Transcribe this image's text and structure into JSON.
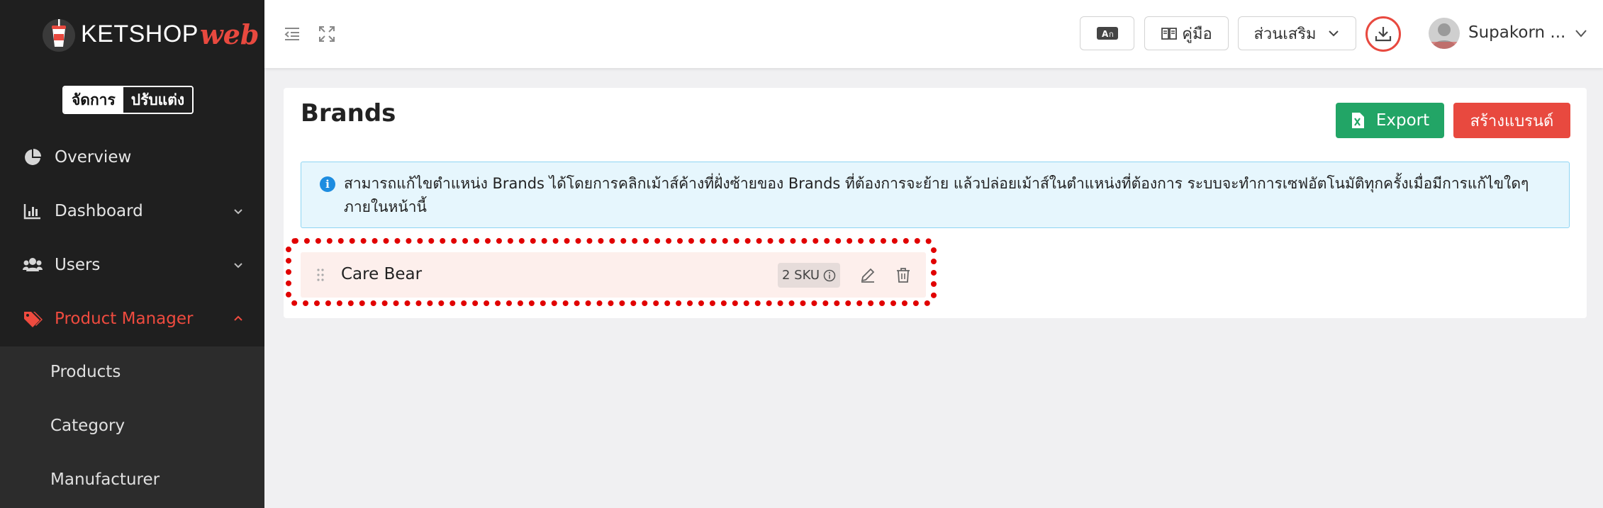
{
  "sidebar": {
    "logo": {
      "text": "KETSHOP",
      "accent": "web"
    },
    "mode_toggle": {
      "active": "จัดการ",
      "inactive": "ปรับแต่ง"
    },
    "items": [
      {
        "label": "Overview",
        "icon": "pie-chart-icon"
      },
      {
        "label": "Dashboard",
        "icon": "bar-chart-icon",
        "expandable": true
      },
      {
        "label": "Users",
        "icon": "users-icon",
        "expandable": true
      },
      {
        "label": "Product Manager",
        "icon": "tag-icon",
        "expanded": true
      }
    ],
    "subitems": [
      {
        "label": "Products"
      },
      {
        "label": "Category"
      },
      {
        "label": "Manufacturer"
      }
    ]
  },
  "header": {
    "translate_icon": "translate-icon",
    "manual_label": "คู่มือ",
    "addons_label": "ส่วนเสริม",
    "user_name": "Supakorn ..."
  },
  "main": {
    "title": "Brands",
    "export_label": "Export",
    "create_label": "สร้างแบรนด์",
    "info_text": "สามารถแก้ไขตำแหน่ง Brands ได้โดยการคลิกเม้าส์ค้างที่ฝั่งซ้ายของ Brands ที่ต้องการจะย้าย แล้วปล่อยเม้าส์ในตำแหน่งที่ต้องการ ระบบจะทำการเซฟอัตโนมัติทุกครั้งเมื่อมีการแก้ไขใดๆ ภายในหน้านี้",
    "brands": [
      {
        "name": "Care Bear",
        "sku": "2 SKU"
      }
    ]
  },
  "colors": {
    "accent": "#e8493f",
    "export_green": "#22a566",
    "sidebar_bg": "#1f1f1f",
    "info_bg": "#e6f6fd",
    "highlight": "#e10000"
  }
}
